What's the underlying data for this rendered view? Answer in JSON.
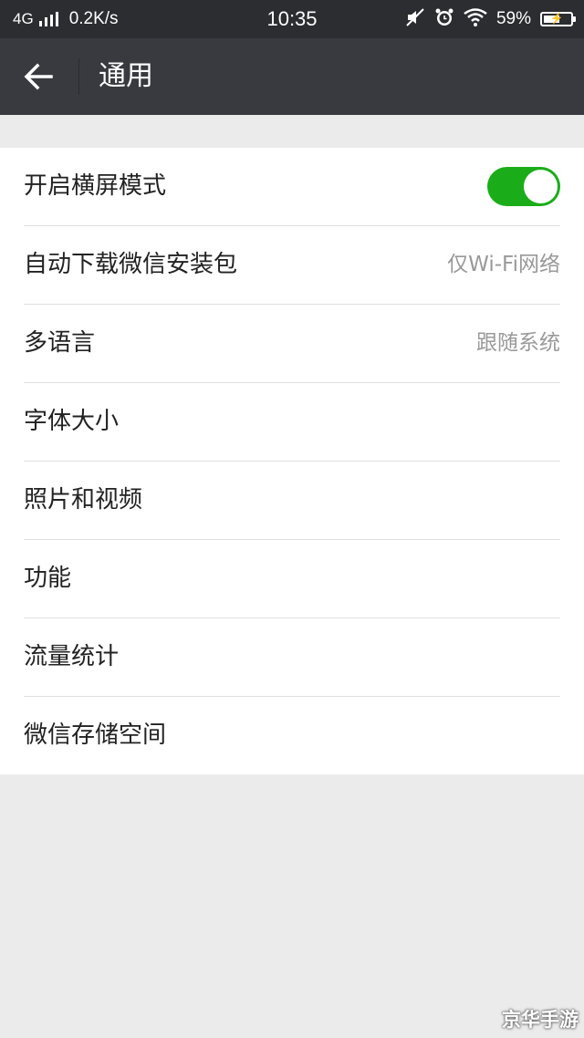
{
  "status_bar": {
    "network_type": "4G",
    "speed": "0.2K/s",
    "time": "10:35",
    "battery_percent": "59%",
    "battery_level": 0.59,
    "icons": [
      "signal-icon",
      "mute-icon",
      "alarm-icon",
      "wifi-icon",
      "battery-icon"
    ]
  },
  "header": {
    "title": "通用",
    "back_icon": "arrow-left-icon"
  },
  "settings": {
    "landscape_mode": {
      "label": "开启横屏模式",
      "enabled": true,
      "accent": "#1aad19"
    },
    "auto_download": {
      "label": "自动下载微信安装包",
      "value": "仅Wi-Fi网络"
    },
    "language": {
      "label": "多语言",
      "value": "跟随系统"
    },
    "font_size": {
      "label": "字体大小"
    },
    "photos_videos": {
      "label": "照片和视频"
    },
    "features": {
      "label": "功能"
    },
    "data_usage": {
      "label": "流量统计"
    },
    "storage": {
      "label": "微信存储空间"
    }
  },
  "watermark": "京华手游",
  "colors": {
    "status_bar_bg": "#2b2d31",
    "title_bar_bg": "#393a3f",
    "page_bg": "#ebebeb",
    "toggle_on": "#1aad19"
  }
}
